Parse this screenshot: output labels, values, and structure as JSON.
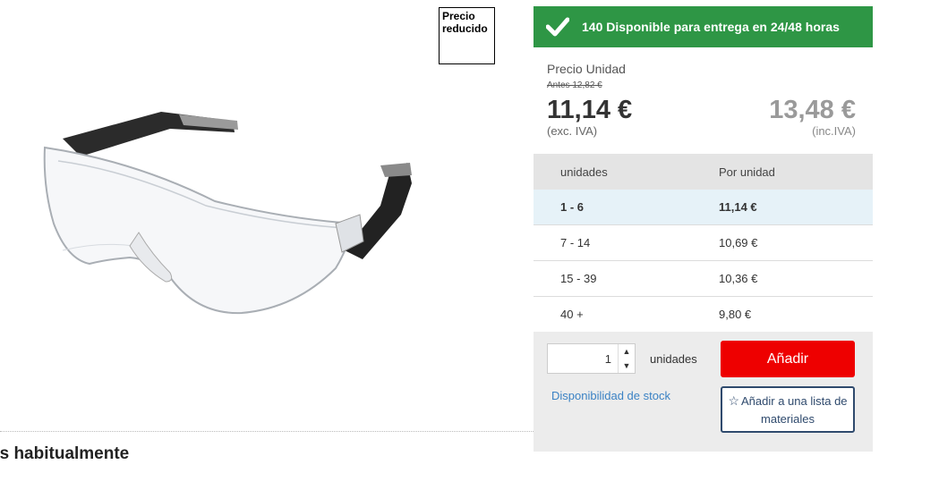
{
  "badge": {
    "line1": "Precio",
    "line2": "reducido"
  },
  "availability": {
    "text": "140 Disponible para entrega en 24/48 horas",
    "color": "#2e9645"
  },
  "price": {
    "label": "Precio Unidad",
    "before": "Antes 12,82 €",
    "excl_vat": "11,14 €",
    "excl_note": "(exc. IVA)",
    "incl_vat": "13,48 €",
    "incl_note": "(inc.IVA)"
  },
  "tiers": {
    "header_qty": "unidades",
    "header_price": "Por unidad",
    "rows": [
      {
        "qty": "1 - 6",
        "price": "11,14 €"
      },
      {
        "qty": "7 - 14",
        "price": "10,69 €"
      },
      {
        "qty": "15 - 39",
        "price": "10,36 €"
      },
      {
        "qty": "40 +",
        "price": "9,80 €"
      }
    ]
  },
  "quantity": {
    "value": "1",
    "unit_label": "unidades"
  },
  "buttons": {
    "add": "Añadir",
    "add_list": "Añadir a una lista de materiales"
  },
  "links": {
    "stock": "Disponibilidad de stock"
  },
  "section": {
    "heading": "os habitualmente"
  },
  "icons": {
    "check": "check-icon",
    "star": "star-outline-icon",
    "up": "caret-up-icon",
    "down": "caret-down-icon"
  },
  "colors": {
    "add_button": "#ee0000",
    "link": "#3b82c4",
    "active_tier_bg": "#e6f2f8"
  }
}
